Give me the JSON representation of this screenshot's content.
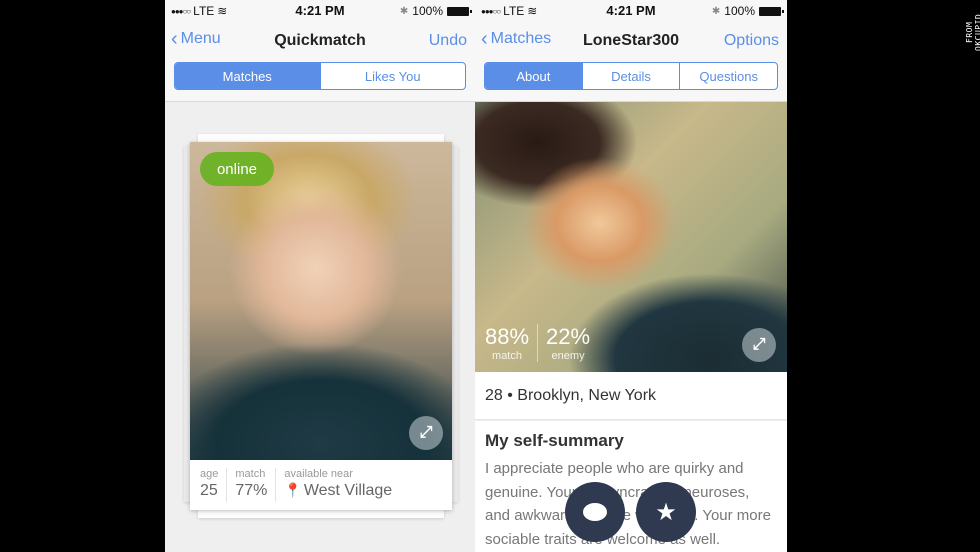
{
  "left_screen": {
    "status_bar": {
      "signal": "●●●○○",
      "carrier": "LTE",
      "time": "4:21 PM",
      "battery": "100%"
    },
    "nav": {
      "back_label": "Menu",
      "title": "Quickmatch",
      "right_label": "Undo"
    },
    "segments": [
      {
        "label": "Matches",
        "active": true
      },
      {
        "label": "Likes You",
        "active": false
      }
    ],
    "card": {
      "status_badge": "online",
      "age_label": "age",
      "age_value": "25",
      "match_label": "match",
      "match_value": "77%",
      "location_label": "available near",
      "location_value": "West Village"
    }
  },
  "right_screen": {
    "status_bar": {
      "signal": "●●●○○",
      "carrier": "LTE",
      "time": "4:21 PM",
      "battery": "100%"
    },
    "nav": {
      "back_label": "Matches",
      "title": "LoneStar300",
      "right_label": "Options"
    },
    "segments": [
      {
        "label": "About",
        "active": true
      },
      {
        "label": "Details",
        "active": false
      },
      {
        "label": "Questions",
        "active": false
      }
    ],
    "stats": {
      "match_value": "88%",
      "match_label": "match",
      "enemy_value": "22%",
      "enemy_label": "enemy"
    },
    "location": "28 • Brooklyn, New York",
    "summary": {
      "title": "My self-summary",
      "text": "I appreciate people who are quirky and genuine. Your idiosyncrasies, neuroses, and awkwardness are welcome. Your more sociable traits are welcome as well."
    }
  },
  "icons": {
    "chevron": "‹",
    "wifi": "≋",
    "bluetooth": "✱",
    "expand": "⤢",
    "pin": "⬤",
    "message": "💬",
    "star": "★"
  },
  "credit": "FROM OKCUPID",
  "colors": {
    "accent": "#5b8ee6",
    "online": "#68b222",
    "fab": "#2f3a50",
    "pin": "#ef6a47"
  }
}
